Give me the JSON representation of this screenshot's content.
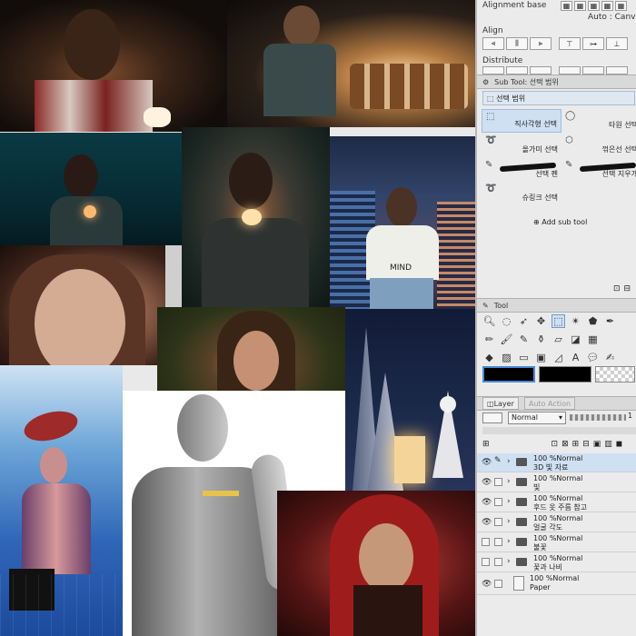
{
  "panel": {
    "alignment_base_label": "Alignment base",
    "alignment_base_value": "Auto : Canv",
    "align_label": "Align",
    "distribute_label": "Distribute",
    "subtool_header": "Sub Tool: 선택 범위",
    "subtool_group": "선택 범위",
    "subtools": [
      {
        "label": "직사각형 선택",
        "icon": "rect-select-icon"
      },
      {
        "label": "타원 선택",
        "icon": "ellipse-select-icon"
      },
      {
        "label": "올가미 선택",
        "icon": "lasso-select-icon"
      },
      {
        "label": "꺾은선 선택",
        "icon": "polyline-select-icon"
      },
      {
        "label": "선택 펜",
        "icon": "selection-pen-icon"
      },
      {
        "label": "선택 지우개",
        "icon": "selection-eraser-icon"
      },
      {
        "label": "슈링크 선택",
        "icon": "shrink-select-icon"
      }
    ],
    "add_subtool": "Add sub tool",
    "tool_header": "Tool",
    "layer_tab": "Layer",
    "auto_action_tab": "Auto Action",
    "blend_mode": "Normal",
    "layers": [
      {
        "line1": "100 %Normal",
        "line2": "3D 빛 자료",
        "selected": true,
        "folder": true
      },
      {
        "line1": "100 %Normal",
        "line2": "빛",
        "selected": false,
        "folder": true
      },
      {
        "line1": "100 %Normal",
        "line2": "후드 옷 주름 참고",
        "selected": false,
        "folder": true
      },
      {
        "line1": "100 %Normal",
        "line2": "얼굴 각도",
        "selected": false,
        "folder": true
      },
      {
        "line1": "100 %Normal",
        "line2": "불꽃",
        "selected": false,
        "folder": true
      },
      {
        "line1": "100 %Normal",
        "line2": "꽃과 나비",
        "selected": false,
        "folder": true
      },
      {
        "line1": "100 %Normal",
        "line2": "Paper",
        "selected": false,
        "folder": false
      }
    ]
  },
  "canvas": {
    "photo_tshirt_text": "MIND"
  },
  "colors": {
    "selected_row": "#cfe0f3",
    "accent": "#3b7fd0"
  }
}
